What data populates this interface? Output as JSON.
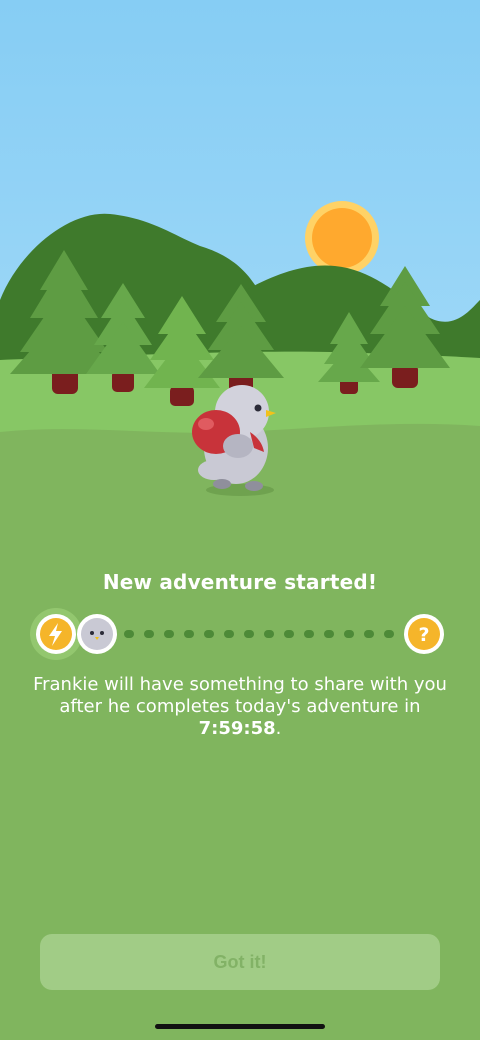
{
  "scene": {
    "illustration": "forest-adventure",
    "character_name": "Frankie",
    "colors": {
      "sky": "#8fd2f5",
      "hill_dark": "#3f7a2c",
      "grass": "#80b55e",
      "sun": "#ffa92e",
      "bag": "#c8333a"
    }
  },
  "headline": "New adventure started!",
  "progress": {
    "start_icon": "lightning-bolt-icon",
    "avatar_icon": "bird-face-icon",
    "end_icon": "question-mark-icon",
    "end_glyph": "?",
    "accent": "#f5b52a"
  },
  "message": {
    "text": "Frankie will have something to share with you after he completes today's adventure in",
    "timer": "7:59:58",
    "suffix": "."
  },
  "button": {
    "label": "Got it!"
  }
}
